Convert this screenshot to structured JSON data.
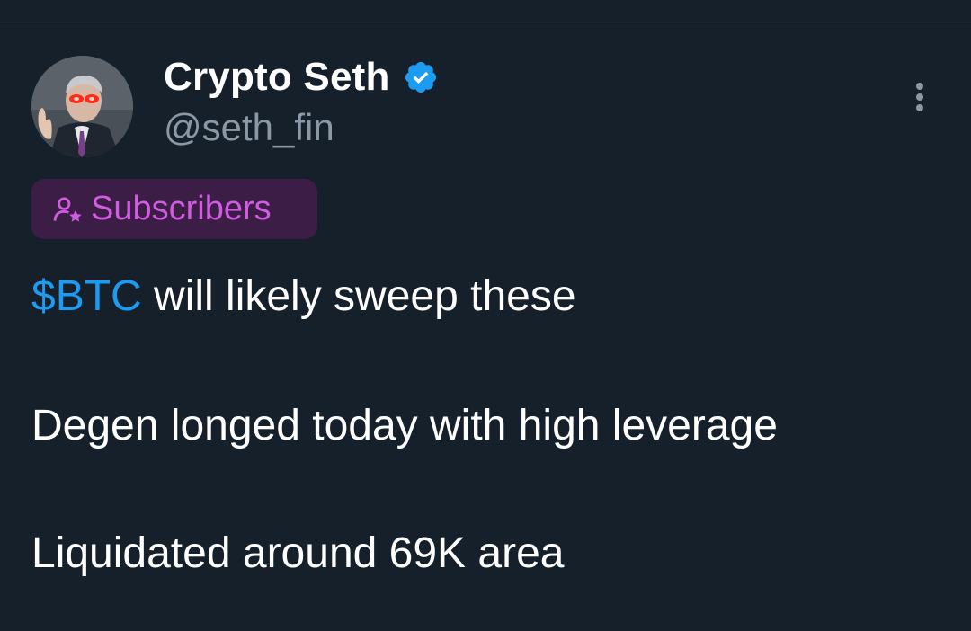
{
  "author": {
    "display_name": "Crypto Seth",
    "handle": "@seth_fin",
    "verified": true,
    "verified_color": "#1d9bf0"
  },
  "badge": {
    "label": "Subscribers",
    "icon": "subscriber-star-icon",
    "color": "#d05ce0"
  },
  "tweet": {
    "cashtag": "$BTC",
    "line1_rest": " will likely sweep these",
    "line2": "Degen longed today with high leverage",
    "line3": "Liquidated around 69K area"
  },
  "icons": {
    "more": "more-vertical-icon",
    "verified": "verified-badge-icon"
  }
}
